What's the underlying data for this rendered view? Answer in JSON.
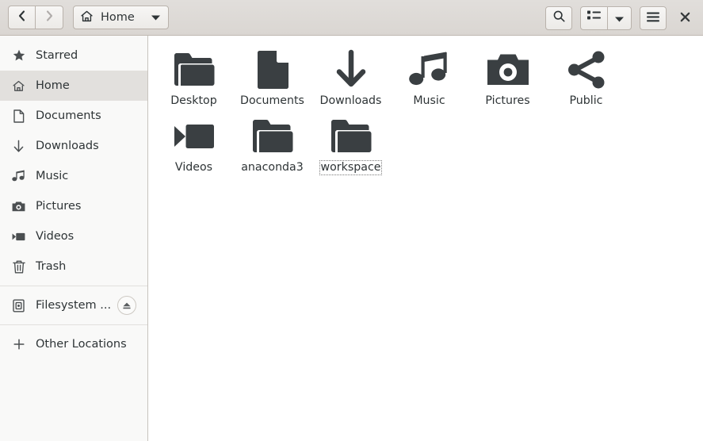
{
  "window": {
    "title": "Home"
  },
  "header": {
    "back_button": "back-arrow",
    "forward_button": "forward-arrow",
    "path_label": "Home",
    "path_icon": "home-icon",
    "path_dropdown": "chevron-down-icon",
    "search_button": "search-icon",
    "view_button": "list-view-icon",
    "view_dropdown": "chevron-down-icon",
    "menu_button": "hamburger-menu-icon",
    "close_button": "close-icon"
  },
  "sidebar": {
    "groups": [
      {
        "items": [
          {
            "label": "Starred",
            "icon": "star-icon",
            "selected": false
          },
          {
            "label": "Home",
            "icon": "home-icon",
            "selected": true
          },
          {
            "label": "Documents",
            "icon": "document-icon",
            "selected": false
          },
          {
            "label": "Downloads",
            "icon": "download-arrow-icon",
            "selected": false
          },
          {
            "label": "Music",
            "icon": "music-note-icon",
            "selected": false
          },
          {
            "label": "Pictures",
            "icon": "camera-icon",
            "selected": false
          },
          {
            "label": "Videos",
            "icon": "video-icon",
            "selected": false
          },
          {
            "label": "Trash",
            "icon": "trash-icon",
            "selected": false
          }
        ]
      },
      {
        "items": [
          {
            "label": "Filesystem ...",
            "icon": "drive-icon",
            "selected": false,
            "eject": "eject-icon"
          }
        ]
      },
      {
        "items": [
          {
            "label": "Other Locations",
            "icon": "plus-icon",
            "selected": false
          }
        ]
      }
    ]
  },
  "files": [
    {
      "name": "Desktop",
      "icon": "folder-icon",
      "focused": false
    },
    {
      "name": "Documents",
      "icon": "document-icon",
      "focused": false
    },
    {
      "name": "Downloads",
      "icon": "download-arrow-icon",
      "focused": false
    },
    {
      "name": "Music",
      "icon": "music-note-icon",
      "focused": false
    },
    {
      "name": "Pictures",
      "icon": "camera-icon",
      "focused": false
    },
    {
      "name": "Public",
      "icon": "share-icon",
      "focused": false
    },
    {
      "name": "Videos",
      "icon": "video-icon",
      "focused": false
    },
    {
      "name": "anaconda3",
      "icon": "folder-icon",
      "focused": false
    },
    {
      "name": "workspace",
      "icon": "folder-icon",
      "focused": true
    }
  ],
  "colors": {
    "header_bg": "#dcd8d4",
    "sidebar_bg": "#f9f9f8",
    "selection_bg": "#e2e0dd",
    "content_bg": "#ffffff",
    "icon_fg": "#3a3f42",
    "text_fg": "#2e3436"
  }
}
